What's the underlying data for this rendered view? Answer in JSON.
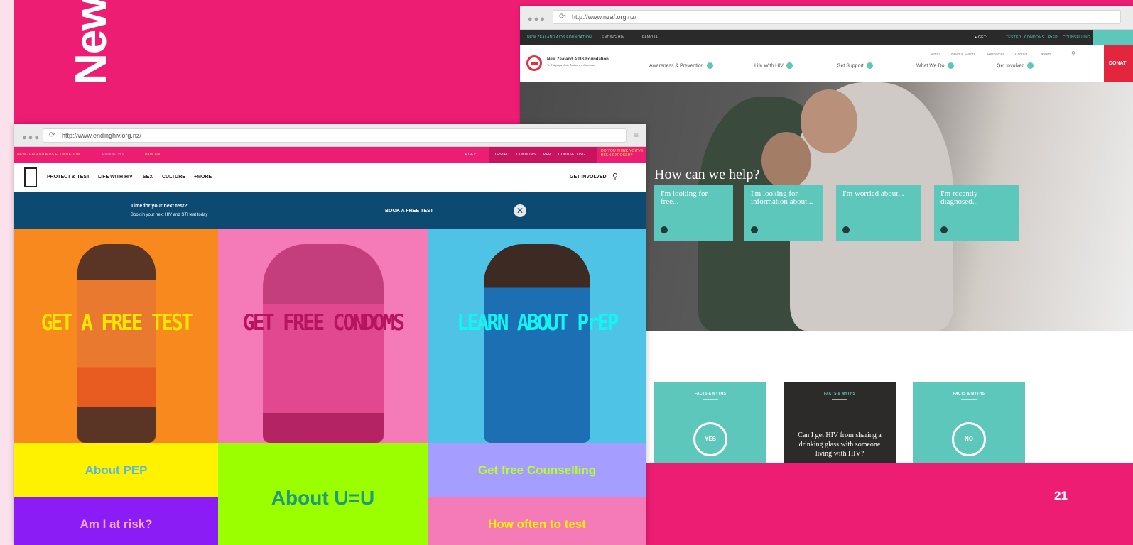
{
  "slide": {
    "title": "New",
    "page_number": "21",
    "bg_color": "#ee1d74"
  },
  "back_browser": {
    "url": "http://www.nzaf.org.nz/",
    "topbar": [
      "NEW ZEALAND AIDS FOUNDATION",
      "ENDING HIV",
      "PAMOJA"
    ],
    "get_label": "GET:",
    "get_items": [
      "TESTED",
      "CONDOMS",
      "PrEP",
      "COUNSELLING"
    ],
    "org_name": "New Zealand AIDS Foundation",
    "org_sub": "Te Tūāpapa Mate Āraikore o Aotearoa",
    "nav": [
      "Awareness & Prevention",
      "Life With HIV",
      "Get Support",
      "What We Do",
      "Get Involved"
    ],
    "subnav": [
      "About",
      "News & Events",
      "Resources",
      "Contact",
      "Careers"
    ],
    "donate": "DONAT",
    "hero_heading": "How can we help?",
    "help_boxes": [
      "I'm looking for free...",
      "I'm looking for information about...",
      "I'm worried about...",
      "I'm recently diagnosed..."
    ],
    "cards": [
      {
        "label": "FACTS & MYTHS",
        "answer": "YES",
        "color": "#5dc7bc"
      },
      {
        "label": "FACTS & MYTHS",
        "question": "Can I get HIV from sharing a drinking glass with someone living with HIV?",
        "color": "#2d2a2a"
      },
      {
        "label": "FACTS & MYTHS",
        "answer": "NO",
        "color": "#5dc7bc"
      }
    ]
  },
  "front_browser": {
    "url": "http://www.endinghiv.org.nz/",
    "topbar": [
      "NEW ZEALAND AIDS FOUNDATION",
      "ENDING HIV",
      "PAMOJA"
    ],
    "get_label": "GET:",
    "get_items": [
      "TESTED",
      "CONDOMS",
      "PEP",
      "COUNSELLING"
    ],
    "exposed_label": "DO YOU THINK YOU'VE BEEN EXPOSED?",
    "nav": [
      "PROTECT & TEST",
      "LIFE WITH HIV",
      "SEX",
      "CULTURE",
      "+MORE"
    ],
    "get_involved": "GET INVOLVED",
    "banner_title": "Time for your next test?",
    "banner_sub": "Book in your next HIV and STI test today",
    "banner_cta": "BOOK A FREE TEST",
    "panels": [
      {
        "text": "GET A FREE TEST",
        "bg": "#f7891f",
        "text_color": "#ffe600"
      },
      {
        "text": "GET FREE CONDOMS",
        "bg": "#f57ab8",
        "text_color": "#b5145f"
      },
      {
        "text": "LEARN ABOUT PrEP",
        "bg": "#4fc3e6",
        "text_color": "#13f5f0"
      }
    ],
    "tiles": [
      {
        "text": "About PEP",
        "bg": "#fff200",
        "color": "#58b7e0"
      },
      {
        "text": "About U=U",
        "bg": "#9bff00",
        "color": "#1f9a7a"
      },
      {
        "text": "Get free Counselling",
        "bg": "#a59dff",
        "color": "#b8ff2a"
      },
      {
        "text": "Am I at risk?",
        "bg": "#8b1cf5",
        "color": "#f7a4d4"
      },
      {
        "text": "How often to test",
        "bg": "#f57ab8",
        "color": "#fff200"
      }
    ]
  }
}
